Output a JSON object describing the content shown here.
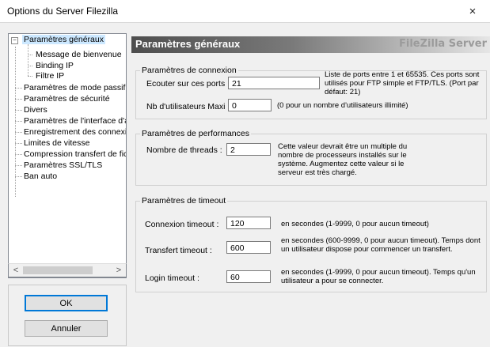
{
  "window": {
    "title": "Options du Server Filezilla",
    "close_glyph": "×"
  },
  "tree": {
    "items": [
      {
        "label": "Paramètres généraux",
        "selected": true
      },
      {
        "label": "Message de bienvenue"
      },
      {
        "label": "Binding IP"
      },
      {
        "label": "Filtre IP"
      },
      {
        "label": "Paramètres de mode passif"
      },
      {
        "label": "Paramètres de sécurité"
      },
      {
        "label": "Divers"
      },
      {
        "label": "Paramètres de l'interface d'ad"
      },
      {
        "label": "Enregistrement des connexio"
      },
      {
        "label": "Limites de vitesse"
      },
      {
        "label": "Compression transfert de fich"
      },
      {
        "label": "Paramètres SSL/TLS"
      },
      {
        "label": "Ban auto"
      }
    ],
    "expand_glyph": "−"
  },
  "scroll": {
    "left_arrow": "<",
    "right_arrow": ">"
  },
  "buttons": {
    "ok": "OK",
    "cancel": "Annuler"
  },
  "header": {
    "title": "Paramètres généraux",
    "brand": "FileZilla Server"
  },
  "connection": {
    "legend": "Paramètres de connexion",
    "ports_label": "Ecouter sur ces ports :",
    "ports_value": "21",
    "ports_desc": "Liste de ports entre 1 et 65535. Ces ports sont utilisés pour FTP simple et FTP/TLS. (Port par défaut: 21)",
    "max_users_label": "Nb d'utilisateurs Maxi :",
    "max_users_value": "0",
    "max_users_desc": "(0 pour un nombre d'utilisateurs illimité)"
  },
  "performance": {
    "legend": "Paramètres de performances",
    "threads_label": "Nombre de threads :",
    "threads_value": "2",
    "threads_desc": "Cette valeur devrait être un multiple du nombre de processeurs installés sur le système. Augmentez cette valeur si le serveur est très chargé."
  },
  "timeout": {
    "legend": "Paramètres de timeout",
    "connection_label": "Connexion timeout :",
    "connection_value": "120",
    "connection_desc": "en secondes (1-9999, 0 pour aucun timeout)",
    "transfer_label": "Transfert timeout :",
    "transfer_value": "600",
    "transfer_desc": "en secondes (600-9999, 0 pour aucun timeout). Temps dont un utilisateur dispose pour commencer un transfert.",
    "login_label": "Login timeout :",
    "login_value": "60",
    "login_desc": "en secondes (1-9999, 0 pour aucun timeout). Temps qu'un utilisateur a pour se connecter."
  }
}
